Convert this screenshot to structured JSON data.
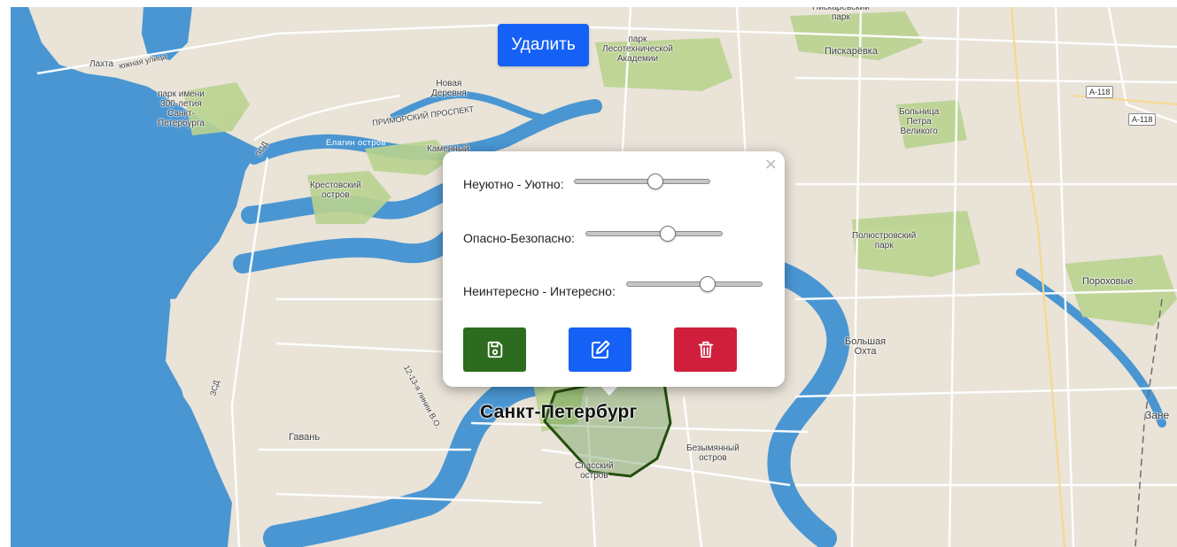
{
  "toolbar": {
    "delete_label": "Удалить"
  },
  "popup": {
    "close_glyph": "×",
    "ratings": [
      {
        "label": "Неуютно - Уютно:",
        "value": 0.6
      },
      {
        "label": "Опасно-Безопасно:",
        "value": 0.6
      },
      {
        "label": "Неинтересно - Интересно:",
        "value": 0.6
      }
    ],
    "buttons": [
      {
        "icon": "save-icon",
        "color": "#2d6b1f"
      },
      {
        "icon": "edit-icon",
        "color": "#1561f5"
      },
      {
        "icon": "trash-icon",
        "color": "#d01f3c"
      }
    ]
  },
  "map": {
    "city_label": "Санкт-Петербург",
    "labels": [
      {
        "text": "Лахта"
      },
      {
        "text": "южная улица"
      },
      {
        "text": "парк имени\n300-летия\nСанкт-\nПетербурга"
      },
      {
        "text": "Новая\nДеревня"
      },
      {
        "text": "ПРИМОРСКИЙ ПРОСПЕКТ"
      },
      {
        "text": "парк\nЛесотехнической\nАкадемии"
      },
      {
        "text": "Пискарёвка"
      },
      {
        "text": "Пискарёвский\nпарк"
      },
      {
        "text": "Больница\nПетра\nВеликого"
      },
      {
        "text": "Елагин остров"
      },
      {
        "text": "Каменный"
      },
      {
        "text": "ЗСД"
      },
      {
        "text": "Крестовский\nостров"
      },
      {
        "text": "Полюстровский\nпарк"
      },
      {
        "text": "Пороховые"
      },
      {
        "text": "Большая\nОхта"
      },
      {
        "text": "ЗСД"
      },
      {
        "text": "12-13-я линии В.О."
      },
      {
        "text": "Гавань"
      },
      {
        "text": "Спасский\nостров"
      },
      {
        "text": "Безымянный\nостров"
      },
      {
        "text": "Зане"
      }
    ],
    "shields": [
      {
        "text": "А-118"
      },
      {
        "text": "А-118"
      }
    ]
  }
}
